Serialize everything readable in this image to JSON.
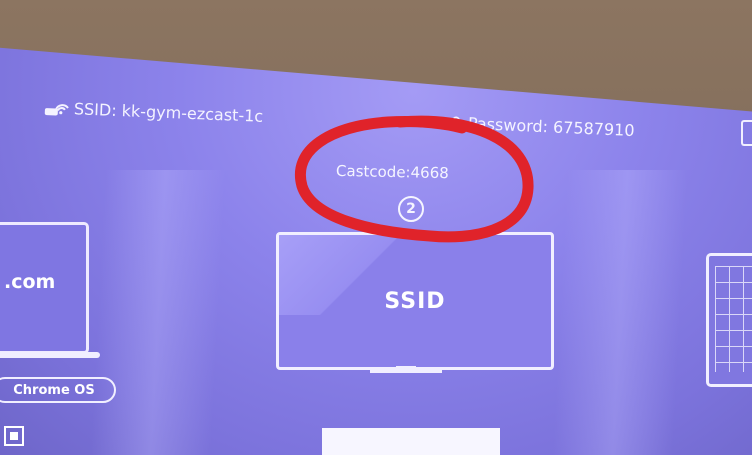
{
  "network": {
    "ssid_text": "SSID: kk-gym-ezcast-1c",
    "password_text": "Password: 67587910"
  },
  "cast": {
    "castcode_text": "Castcode:4668",
    "step_number": "2"
  },
  "panels": {
    "tv_label": "SSID",
    "laptop_label": ".com",
    "chrome_os_label": "Chrome OS"
  },
  "colors": {
    "screen_purple": "#8c83eb",
    "annotation_red": "#e0232a",
    "wall_brown": "#8c7561"
  },
  "icons": {
    "wifi_network": "wifi-cloud-icon",
    "password": "lock-icon",
    "step": "circled-two-icon"
  }
}
